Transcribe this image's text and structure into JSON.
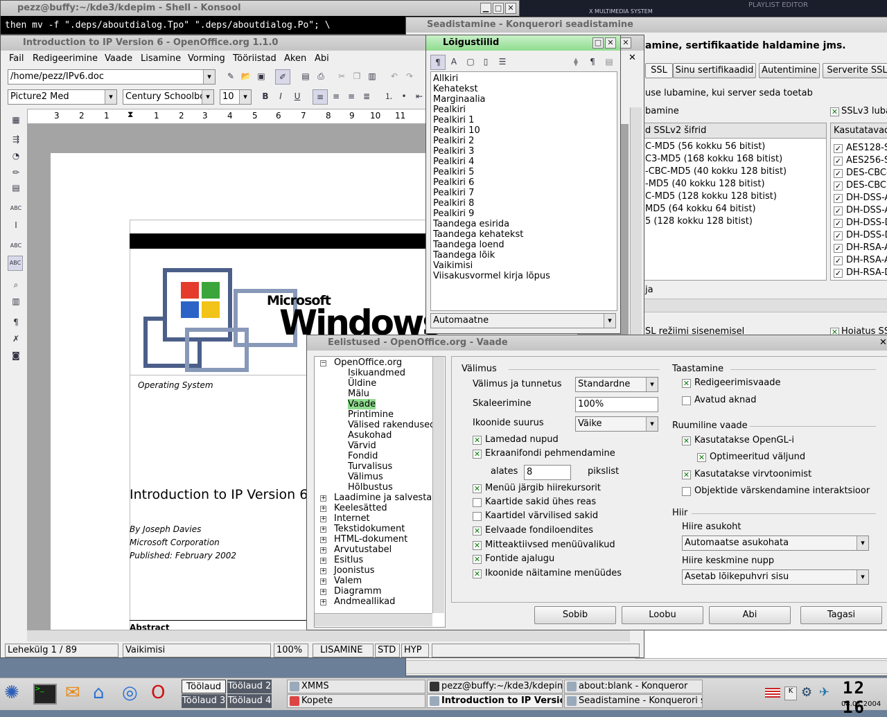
{
  "konsole": {
    "title": "pezz@buffy:~/kde3/kdepim - Shell - Konsool",
    "line": "then mv -f \".deps/aboutdialog.Tpo\" \".deps/aboutdialog.Po\"; \\"
  },
  "xmms": {
    "label": "X MULTIMEDIA SYSTEM",
    "playlist": "PLAYLIST EDITOR"
  },
  "konqueror_settings": {
    "title": "Seadistamine - Konquerori seadistamine",
    "heading": "amine, sertifikaatide haldamine jms.",
    "tabs": [
      "SSL",
      "Sinu sertifikaadid",
      "Autentimine",
      "Serverite SSL"
    ],
    "enable_text": "use lubamine, kui server seda toetab",
    "tls_label": "bamine",
    "sslv3_label": "SSLv3 luba",
    "v2_header": "d SSLv2 šifrid",
    "v2_rows": [
      "C-MD5 (56 kokku 56 bitist)",
      "C3-MD5 (168 kokku 168 bitist)",
      "-CBC-MD5 (40 kokku 128 bitist)",
      "-MD5 (40 kokku 128 bitist)",
      "C-MD5 (128 kokku 128 bitist)",
      "MD5 (64 kokku 64 bitist)",
      "5 (128 kokku 128 bitist)"
    ],
    "v3_header": "Kasutatavad",
    "v3_rows": [
      "AES128-S",
      "AES256-S",
      "DES-CBC-",
      "DES-CBC3",
      "DH-DSS-A",
      "DH-DSS-A",
      "DH-DSS-D",
      "DH-DSS-D",
      "DH-RSA-A",
      "DH-RSA-A",
      "DH-RSA-D"
    ],
    "ja_label": "ja",
    "bottom_label": "SL režiimi sisenemisel",
    "warn_label": "Hoiatus SS"
  },
  "openoffice": {
    "title": "Introduction to IP Version 6 - OpenOffice.org 1.1.0",
    "menu": [
      "Fail",
      "Redigeerimine",
      "Vaade",
      "Lisamine",
      "Vorming",
      "Tööriistad",
      "Aken",
      "Abi"
    ],
    "path": "/home/pezz/IPv6.doc",
    "style": "Picture2 Med",
    "font": "Century Schoolbo",
    "size": "10",
    "ruler": [
      "3",
      "2",
      "1",
      "1",
      "2",
      "3",
      "4",
      "5",
      "6",
      "7",
      "8",
      "9",
      "10",
      "11"
    ],
    "doc": {
      "logo_small": "Microsoft",
      "logo_big": "Windows",
      "os": "Operating System",
      "heading": "Introduction to IP Version 6",
      "author": "By Joseph Davies",
      "company": "Microsoft Corporation",
      "published": "Published: February 2002",
      "abstract": "Abstract"
    },
    "status": [
      "Lehekülg 1 / 89",
      "Vaikimisi",
      "100%",
      "LISAMINE",
      "STD",
      "HYP"
    ]
  },
  "styles_panel": {
    "title": "Lõigustiilid",
    "items": [
      "Allkiri",
      "Kehatekst",
      "Marginaalia",
      "Pealkiri",
      "Pealkiri 1",
      "Pealkiri 10",
      "Pealkiri 2",
      "Pealkiri 3",
      "Pealkiri 4",
      "Pealkiri 5",
      "Pealkiri 6",
      "Pealkiri 7",
      "Pealkiri 8",
      "Pealkiri 9",
      "Taandega esirida",
      "Taandega kehatekst",
      "Taandega loend",
      "Taandega lõik",
      "Vaikimisi",
      "Viisakusvormel kirja lõpus"
    ],
    "filter": "Automaatne"
  },
  "options": {
    "title": "Eelistused - OpenOffice.org - Vaade",
    "tree_root": "OpenOffice.org",
    "tree_children": [
      "Isikuandmed",
      "Üldine",
      "Mälu",
      "Vaade",
      "Printimine",
      "Välised rakendused",
      "Asukohad",
      "Värvid",
      "Fondid",
      "Turvalisus",
      "Välimus",
      "Hõlbustus"
    ],
    "tree_groups": [
      "Laadimine ja salvestam",
      "Keelesätted",
      "Internet",
      "Tekstidokument",
      "HTML-dokument",
      "Arvutustabel",
      "Esitlus",
      "Joonistus",
      "Valem",
      "Diagramm",
      "Andmeallikad"
    ],
    "valimus": {
      "title": "Välimus",
      "look_label": "Välimus ja tunnetus",
      "look_value": "Standardne",
      "scale_label": "Skaleerimine",
      "scale_value": "100%",
      "icon_label": "Ikoonide suurus",
      "icon_value": "Väike",
      "checks": [
        "Lamedad nupud",
        "Ekraanifondi pehmendamine"
      ],
      "from_label": "alates",
      "from_value": "8",
      "pixels": "pikslist",
      "checks2": [
        "Menüü järgib hiirekursorit",
        "Kaartide sakid ühes reas",
        "Kaartidel värvilised sakid",
        "Eelvaade fondiloendites",
        "Mitteaktiivsed menüüvalikud",
        "Fontide ajalugu",
        "Ikoonide näitamine menüüdes"
      ]
    },
    "taastamine": {
      "title": "Taastamine",
      "checks": [
        "Redigeerimisvaade",
        "Avatud aknad"
      ]
    },
    "ruumiline": {
      "title": "Ruumiline vaade",
      "checks": [
        "Kasutatakse OpenGL-i",
        "Optimeeritud väljund",
        "Kasutatakse virvtoonimist",
        "Objektide värskendamine interaktsioor"
      ]
    },
    "hiir": {
      "title": "Hiir",
      "pos_label": "Hiire asukoht",
      "pos_value": "Automaatse asukohata",
      "mid_label": "Hiire keskmine nupp",
      "mid_value": "Asetab lõikepuhvri sisu"
    },
    "buttons": [
      "Sobib",
      "Loobu",
      "Abi",
      "Tagasi"
    ]
  },
  "taskbar": {
    "desktops": [
      "Töölaud 1",
      "Töölaud 2",
      "Töölaud 3",
      "Töölaud 4"
    ],
    "tasks": [
      "XMMS",
      "pezz@buffy:~/kde3/kdepim",
      "about:blank - Konqueror",
      "Kopete",
      "Introduction to IP Versio",
      "Seadistamine - Konquerori s"
    ],
    "clock": "12 16",
    "date": "08.01.2004"
  }
}
